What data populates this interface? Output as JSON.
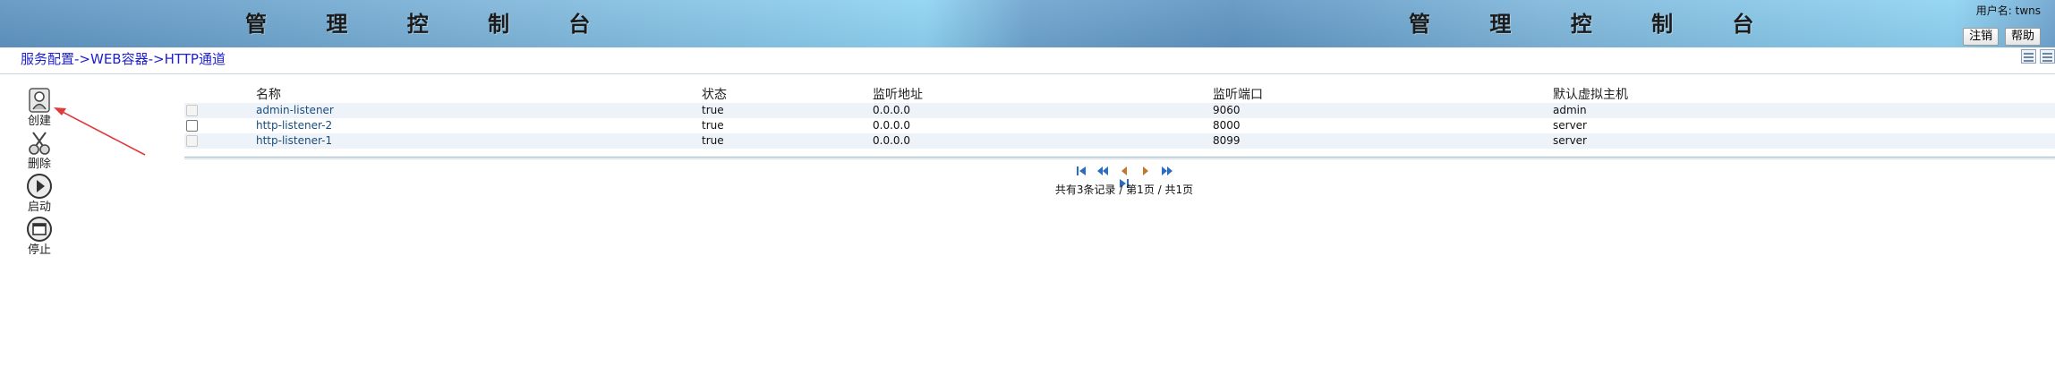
{
  "header": {
    "title_left": "管 理 控 制 台",
    "title_right": "管 理 控 制 台",
    "user_label": "用户名: twns",
    "logout_label": "注销",
    "help_label": "帮助"
  },
  "breadcrumb": {
    "items": [
      "服务配置",
      "WEB容器",
      "HTTP通道"
    ],
    "separator": "->"
  },
  "toolbar": {
    "create_label": "创建",
    "delete_label": "删除",
    "start_label": "启动",
    "stop_label": "停止"
  },
  "table": {
    "columns": [
      "名称",
      "状态",
      "监听地址",
      "监听端口",
      "默认虚拟主机"
    ],
    "rows": [
      {
        "name": "admin-listener",
        "status": "true",
        "address": "0.0.0.0",
        "port": "9060",
        "host": "admin",
        "checkbox_enabled": false
      },
      {
        "name": "http-listener-2",
        "status": "true",
        "address": "0.0.0.0",
        "port": "8000",
        "host": "server",
        "checkbox_enabled": true
      },
      {
        "name": "http-listener-1",
        "status": "true",
        "address": "0.0.0.0",
        "port": "8099",
        "host": "server",
        "checkbox_enabled": false
      }
    ]
  },
  "pagination": {
    "summary": "共有3条记录 / 第1页 / 共1页"
  },
  "colors": {
    "link": "#1f1fcf",
    "row_alt": "#eef3fa",
    "arrow": "#e03a3a"
  }
}
